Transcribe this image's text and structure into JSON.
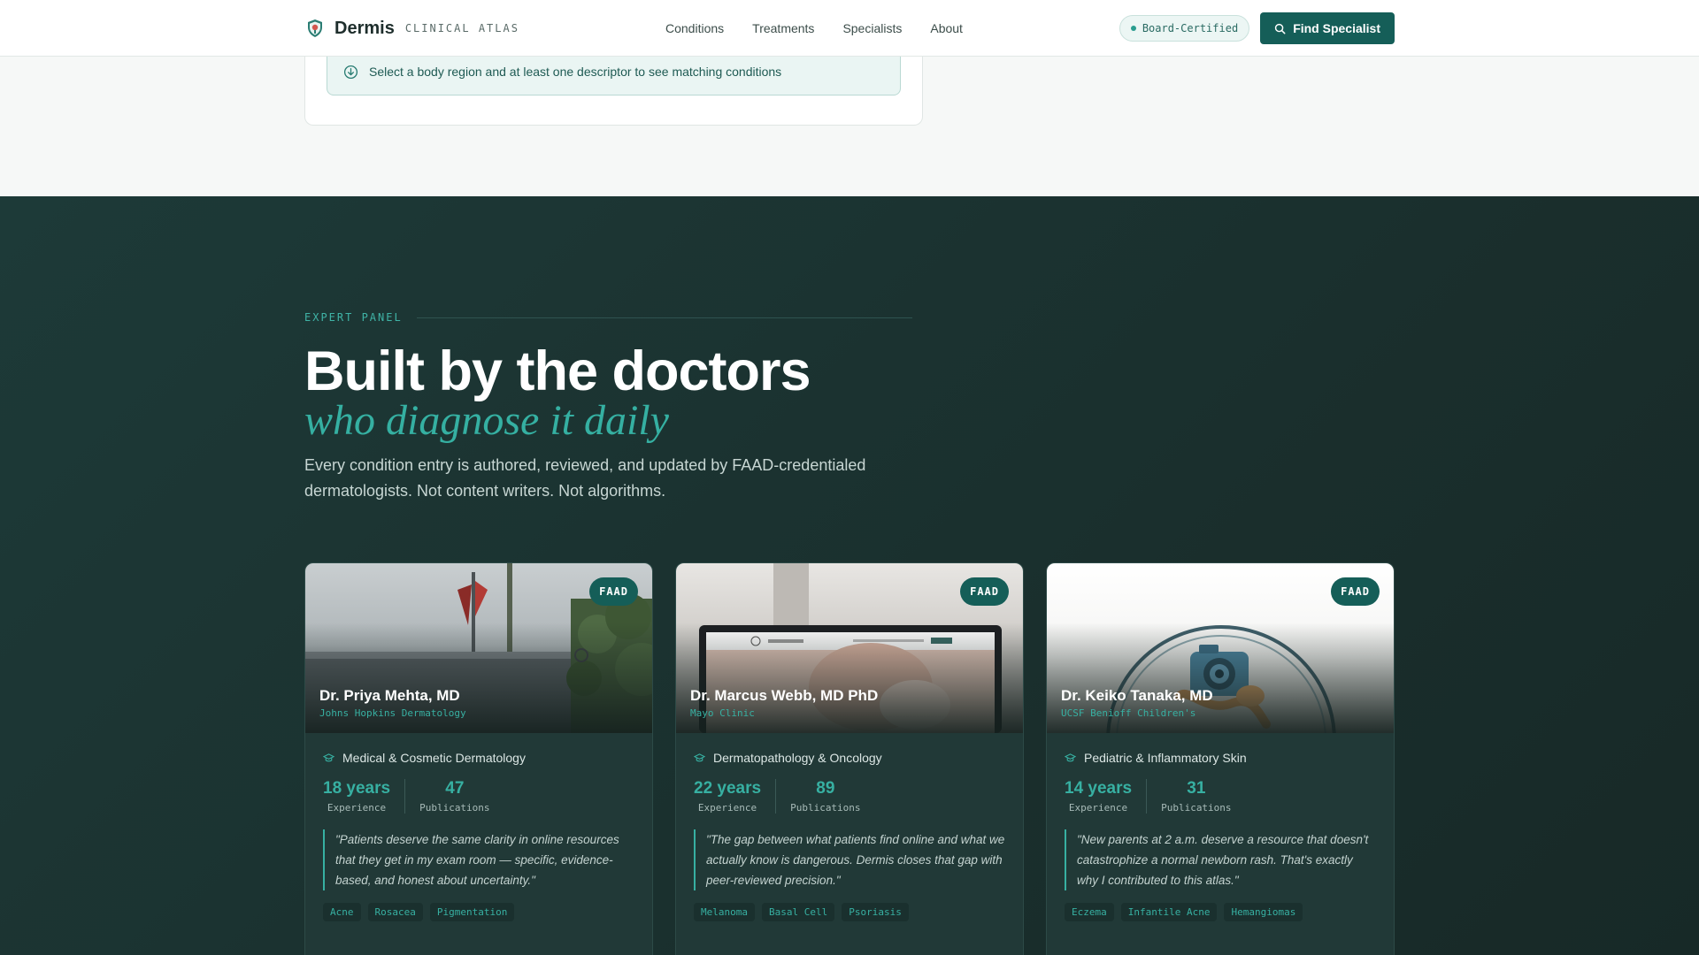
{
  "brand": {
    "name": "Dermis",
    "subtitle": "CLINICAL ATLAS",
    "logo_icon": "shield-logo-icon"
  },
  "nav": [
    {
      "label": "Conditions"
    },
    {
      "label": "Treatments"
    },
    {
      "label": "Specialists"
    },
    {
      "label": "About"
    }
  ],
  "header_actions": {
    "certified_badge": "Board-Certified",
    "find_button": "Find Specialist"
  },
  "selector": {
    "hint": "Select a body region and at least one descriptor to see matching conditions",
    "hint_icon": "arrow-down-circle-icon"
  },
  "expert_panel": {
    "eyebrow": "EXPERT PANEL",
    "headline": "Built by the doctors",
    "headline_italic": "who diagnose it daily",
    "lead": "Every condition entry is authored, reviewed, and updated by FAAD-credentialed dermatologists. Not content writers. Not algorithms."
  },
  "doctors": [
    {
      "badge": "FAAD",
      "name": "Dr. Priya Mehta, MD",
      "institution": "Johns Hopkins Dermatology",
      "specialty": "Medical & Cosmetic Dermatology",
      "stat1_value": "18 years",
      "stat1_label": "Experience",
      "stat2_value": "47",
      "stat2_label": "Publications",
      "quote": "\"Patients deserve the same clarity in online resources that they get in my exam room — specific, evidence-based, and honest about uncertainty.\"",
      "tags": [
        "Acne",
        "Rosacea",
        "Pigmentation"
      ]
    },
    {
      "badge": "FAAD",
      "name": "Dr. Marcus Webb, MD PhD",
      "institution": "Mayo Clinic",
      "specialty": "Dermatopathology & Oncology",
      "stat1_value": "22 years",
      "stat1_label": "Experience",
      "stat2_value": "89",
      "stat2_label": "Publications",
      "quote": "\"The gap between what patients find online and what we actually know is dangerous. Dermis closes that gap with peer-reviewed precision.\"",
      "tags": [
        "Melanoma",
        "Basal Cell",
        "Psoriasis"
      ]
    },
    {
      "badge": "FAAD",
      "name": "Dr. Keiko Tanaka, MD",
      "institution": "UCSF Benioff Children's",
      "specialty": "Pediatric & Inflammatory Skin",
      "stat1_value": "14 years",
      "stat1_label": "Experience",
      "stat2_value": "31",
      "stat2_label": "Publications",
      "quote": "\"New parents at 2 a.m. deserve a resource that doesn't catastrophize a normal newborn rash. That's exactly why I contributed to this atlas.\"",
      "tags": [
        "Eczema",
        "Infantile Acne",
        "Hemangiomas"
      ]
    }
  ],
  "colors": {
    "accent": "#155e58",
    "teal": "#37b0a2",
    "dark_bg": "#1d3a38"
  }
}
